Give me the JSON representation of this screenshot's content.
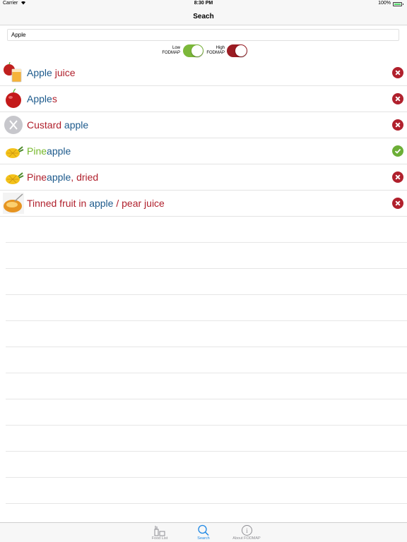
{
  "status_bar": {
    "carrier": "Carrier",
    "time": "8:30 PM",
    "battery": "100%"
  },
  "nav": {
    "title": "Seach"
  },
  "search": {
    "value": "Apple"
  },
  "toggles": [
    {
      "label_line1": "Low",
      "label_line2": "FODMAP",
      "color": "#7cb83a",
      "on": true
    },
    {
      "label_line1": "High",
      "label_line2": "FODMAP",
      "color": "#9b1c23",
      "on": true
    }
  ],
  "colors": {
    "match_blue": "#1d5a8c",
    "high_red": "#b0202c",
    "low_green": "#76b82a",
    "bad_icon": "#b0202c",
    "good_icon": "#6cae36"
  },
  "results": [
    {
      "parts": [
        {
          "text": "Apple",
          "kind": "match"
        },
        {
          "text": " juice",
          "kind": "red"
        }
      ],
      "status": "high",
      "thumb": "apple-juice-icon"
    },
    {
      "parts": [
        {
          "text": "Apple",
          "kind": "match"
        },
        {
          "text": "s",
          "kind": "red"
        }
      ],
      "status": "high",
      "thumb": "apple-icon"
    },
    {
      "parts": [
        {
          "text": "Custard ",
          "kind": "red"
        },
        {
          "text": "apple",
          "kind": "match"
        }
      ],
      "status": "high",
      "thumb": "cutlery-placeholder-icon"
    },
    {
      "parts": [
        {
          "text": "Pine",
          "kind": "green"
        },
        {
          "text": "apple",
          "kind": "match"
        }
      ],
      "status": "low",
      "thumb": "pineapple-icon"
    },
    {
      "parts": [
        {
          "text": "Pine",
          "kind": "red"
        },
        {
          "text": "apple",
          "kind": "match"
        },
        {
          "text": ", dried",
          "kind": "red"
        }
      ],
      "status": "high",
      "thumb": "pineapple-icon"
    },
    {
      "parts": [
        {
          "text": "Tinned fruit in ",
          "kind": "red"
        },
        {
          "text": "apple",
          "kind": "match"
        },
        {
          "text": " / pear juice",
          "kind": "red"
        }
      ],
      "status": "high",
      "thumb": "tinned-fruit-icon"
    }
  ],
  "tabs": [
    {
      "label": "Food List",
      "icon": "food-list-icon",
      "active": false
    },
    {
      "label": "Search",
      "icon": "search-icon",
      "active": true
    },
    {
      "label": "About FODMAP",
      "icon": "info-icon",
      "active": false
    }
  ]
}
